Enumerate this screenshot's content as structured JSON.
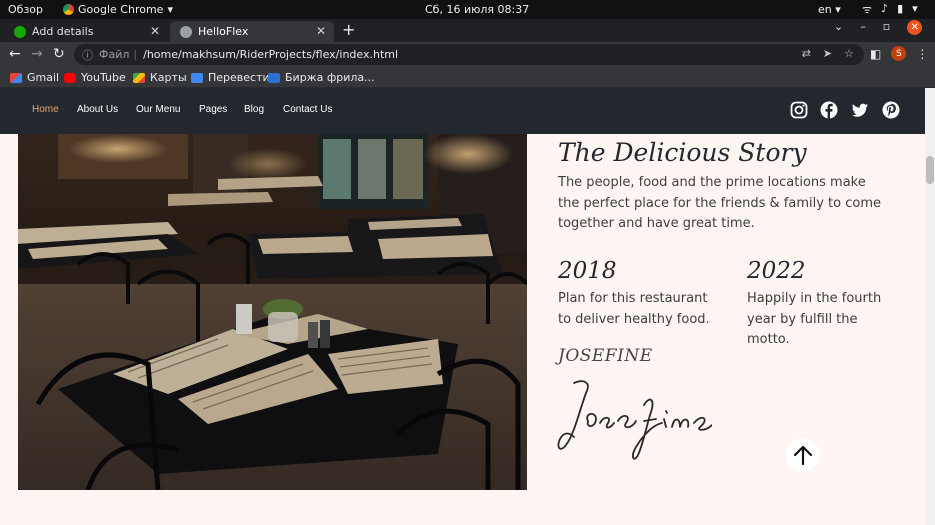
{
  "os": {
    "activities": "Обзор",
    "app_name": "Google Chrome",
    "clock": "Сб, 16 июля  08:37",
    "lang": "en"
  },
  "browser": {
    "tabs": [
      {
        "title": "Add details",
        "active": false
      },
      {
        "title": "HelloFlex",
        "active": true
      }
    ],
    "address": {
      "scheme_label": "Файл",
      "url": "/home/makhsum/RiderProjects/flex/index.html"
    },
    "profile_initial": "S",
    "bookmarks": [
      {
        "label": "Gmail",
        "icon": "gmail-icon"
      },
      {
        "label": "YouTube",
        "icon": "youtube-icon"
      },
      {
        "label": "Карты",
        "icon": "maps-icon"
      },
      {
        "label": "Перевести",
        "icon": "translate-icon"
      },
      {
        "label": "Биржа фрила...",
        "icon": "weblancer-icon"
      }
    ]
  },
  "site": {
    "nav": [
      {
        "label": "Home",
        "current": true
      },
      {
        "label": "About Us"
      },
      {
        "label": "Our Menu"
      },
      {
        "label": "Pages"
      },
      {
        "label": "Blog"
      },
      {
        "label": "Contact Us"
      }
    ],
    "social": [
      "instagram-icon",
      "facebook-icon",
      "twitter-icon",
      "pinterest-icon"
    ],
    "story": {
      "title": "The Delicious Story",
      "text": "The people, food and the prime locations make the perfect place for the friends & family to come together and have great time.",
      "milestones": [
        {
          "year": "2018",
          "text": "Plan for this restaurant to deliver healthy food."
        },
        {
          "year": "2022",
          "text": "Happily in the fourth year by fulfill the motto."
        }
      ],
      "author": "JOSEFINE",
      "signature": "Josefine"
    },
    "colors": {
      "nav_bg": "#23272e",
      "nav_current": "#e7a975",
      "page_bg": "#fff6f3"
    }
  }
}
